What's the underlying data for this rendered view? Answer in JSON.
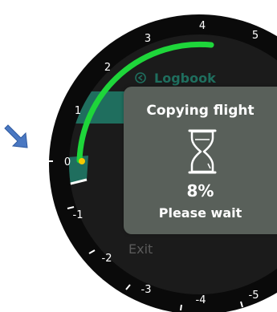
{
  "pointer": {
    "icon": "arrow-down-right-icon",
    "color": "#4a78c2"
  },
  "dial": {
    "scale_labels_top": [
      "5",
      "4",
      "3",
      "2",
      "1"
    ],
    "zero_label": "0",
    "scale_labels_bottom": [
      "-1",
      "-2",
      "-3",
      "-4",
      "-5"
    ],
    "arc_color": "#1ed63a",
    "marker_color": "#f6c800",
    "bezel_color": "#0a0a0a",
    "face_color": "#1b1b1b"
  },
  "menu": {
    "logbook_icon": "back-circle-icon",
    "logbook_label": "Logbook",
    "exit_label": "Exit",
    "accent_color": "#1f6e5e"
  },
  "modal": {
    "title": "Copying flight",
    "icon": "hourglass-icon",
    "progress_text": "8%",
    "progress_value": 8,
    "message": "Please wait",
    "background": "#59605a"
  }
}
